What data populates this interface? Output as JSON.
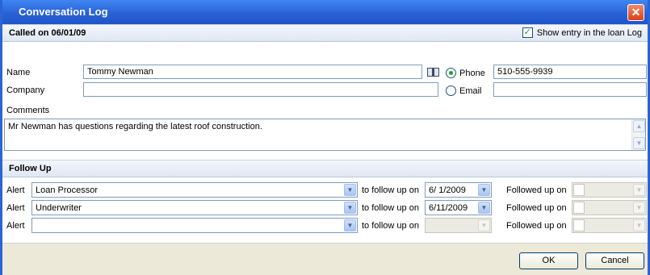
{
  "window": {
    "title": "Conversation Log",
    "close_icon": "close-icon"
  },
  "header": {
    "called_on": "Called on 06/01/09",
    "show_entry_label": "Show entry in the loan Log",
    "show_entry_checked": true
  },
  "contact": {
    "name_label": "Name",
    "name_value": "Tommy Newman",
    "company_label": "Company",
    "company_value": "",
    "phone_label": "Phone",
    "phone_value": "510-555-9939",
    "phone_selected": true,
    "email_label": "Email",
    "email_value": "",
    "address_book_icon": "address-book-icon"
  },
  "comments": {
    "label": "Comments",
    "text": "Mr Newman has questions regarding the latest roof construction."
  },
  "follow_up": {
    "title": "Follow Up",
    "rows": [
      {
        "alert_label": "Alert",
        "alert_value": "Loan Processor",
        "follow_label": "to follow up on",
        "follow_date": "6/ 1/2009",
        "followed_label": "Followed up on",
        "followed_date": ""
      },
      {
        "alert_label": "Alert",
        "alert_value": "Underwriter",
        "follow_label": "to follow up on",
        "follow_date": "6/11/2009",
        "followed_label": "Followed up on",
        "followed_date": ""
      },
      {
        "alert_label": "Alert",
        "alert_value": "",
        "follow_label": "to follow up on",
        "follow_date": "",
        "followed_label": "Followed up on",
        "followed_date": ""
      }
    ]
  },
  "footer": {
    "ok_label": "OK",
    "cancel_label": "Cancel"
  },
  "colors": {
    "titlebar": "#2a62d6",
    "accent_check": "#21a121"
  }
}
